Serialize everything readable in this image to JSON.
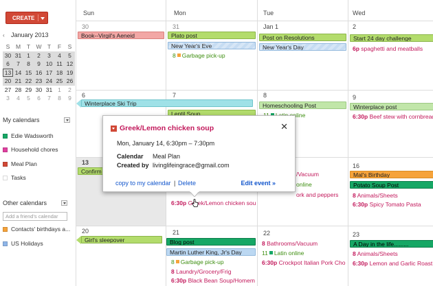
{
  "sidebar": {
    "create_label": "CREATE",
    "month_title": "January 2013",
    "mini_dow": [
      "S",
      "M",
      "T",
      "W",
      "T",
      "F",
      "S"
    ],
    "mini_weeks": [
      [
        "30",
        "31",
        "1",
        "2",
        "3",
        "4",
        "5"
      ],
      [
        "6",
        "7",
        "8",
        "9",
        "10",
        "11",
        "12"
      ],
      [
        "13",
        "14",
        "15",
        "16",
        "17",
        "18",
        "19"
      ],
      [
        "20",
        "21",
        "22",
        "23",
        "24",
        "25",
        "26"
      ],
      [
        "27",
        "28",
        "29",
        "30",
        "31",
        "1",
        "2"
      ],
      [
        "3",
        "4",
        "5",
        "6",
        "7",
        "8",
        "9"
      ]
    ],
    "my_calendars_label": "My calendars",
    "my_calendars": [
      {
        "name": "Edie Wadsworth",
        "color": "#16a765"
      },
      {
        "name": "Household chores",
        "color": "#e040a0"
      },
      {
        "name": "Meal Plan",
        "color": "#d14836"
      },
      {
        "name": "Tasks",
        "color": "#ffffff"
      }
    ],
    "other_calendars_label": "Other calendars",
    "add_friend_placeholder": "Add a friend's calendar",
    "other_calendars": [
      {
        "name": "Contacts' birthdays a...",
        "color": "#f6a33a"
      },
      {
        "name": "US Holidays",
        "color": "#8fb6e8"
      }
    ]
  },
  "grid": {
    "days": [
      "Sun",
      "Mon",
      "Tue",
      "Wed"
    ],
    "week1": {
      "nums": [
        "30",
        "31",
        "Jan 1",
        "2"
      ],
      "book": "Book--Virgil's Aeneid",
      "plato": "Plato post",
      "nye": "New Year's Eve",
      "garbage": {
        "num": "8",
        "text": "Garbage pick-up"
      },
      "post_resolutions": "Post on Resolutions",
      "nyd": "New Year's Day",
      "start24": "Start 24 day challenge",
      "spaghetti": {
        "time": "6p",
        "text": "spaghetti and meatballs"
      }
    },
    "week2": {
      "nums": [
        "6",
        "7",
        "8",
        "9"
      ],
      "ski": "Winterplace Ski Trip",
      "lentil": "Lentil Soup",
      "homeschool": "Homeschooling Post",
      "winterplace": "Winterplace post",
      "latin": {
        "num": "11",
        "text": "Latin online"
      },
      "beef": {
        "time": "6:30p",
        "text": "Beef stew with cornbread"
      }
    },
    "week3": {
      "nums": [
        "13",
        "16"
      ],
      "confirm": "Confirm",
      "vacuum": "/Vacuum",
      "latin": "online",
      "pork": "ork and peppers",
      "mals": "Mal's Birthday",
      "potato": "Potato Soup Post",
      "animals": {
        "num": "8",
        "text": "Animals/Sheets"
      },
      "tomato": {
        "time": "6:30p",
        "text": "Spicy Tomato Pasta"
      },
      "greek": {
        "time": "6:30p",
        "text": "Greek/Lemon chicken sou"
      }
    },
    "week4": {
      "nums": [
        "20",
        "21",
        "22",
        "23"
      ],
      "sleepover": "Girl's sleepover",
      "blog": "Blog post",
      "mlk": "Martin Luther King, Jr's Day",
      "garbage": {
        "num": "8",
        "text": "Garbage pick-up"
      },
      "laundry": {
        "num": "8",
        "text": "Laundry/Grocery/Frig"
      },
      "blackbean": {
        "time": "6:30p",
        "text": "Black Bean Soup/Homem"
      },
      "bathrooms": {
        "num": "8",
        "text": "Bathrooms/Vacuum"
      },
      "latin": {
        "num": "11",
        "text": "Latin online"
      },
      "crockpot": {
        "time": "6:30p",
        "text": "Crockpot Italian Pork Cho"
      },
      "dayinlife": "A Day in the life.........",
      "animals": {
        "num": "8",
        "text": "Animals/Sheets"
      },
      "lemon": {
        "time": "6:30p",
        "text": "Lemon and Garlic Roast"
      }
    }
  },
  "popup": {
    "title": "Greek/Lemon chicken soup",
    "datetime": "Mon, January 14, 6:30pm – 7:30pm",
    "calendar_label": "Calendar",
    "calendar_value": "Meal Plan",
    "created_label": "Created by",
    "created_value": "livinglifeingrace@gmail.com",
    "copy_link": "copy to my calendar",
    "sep": "|",
    "delete_link": "Delete",
    "edit_link": "Edit event »"
  },
  "colors": {
    "accent": "#d14836",
    "meal": "#c2185b",
    "link": "#1155cc",
    "green": "#b3dc6c"
  }
}
